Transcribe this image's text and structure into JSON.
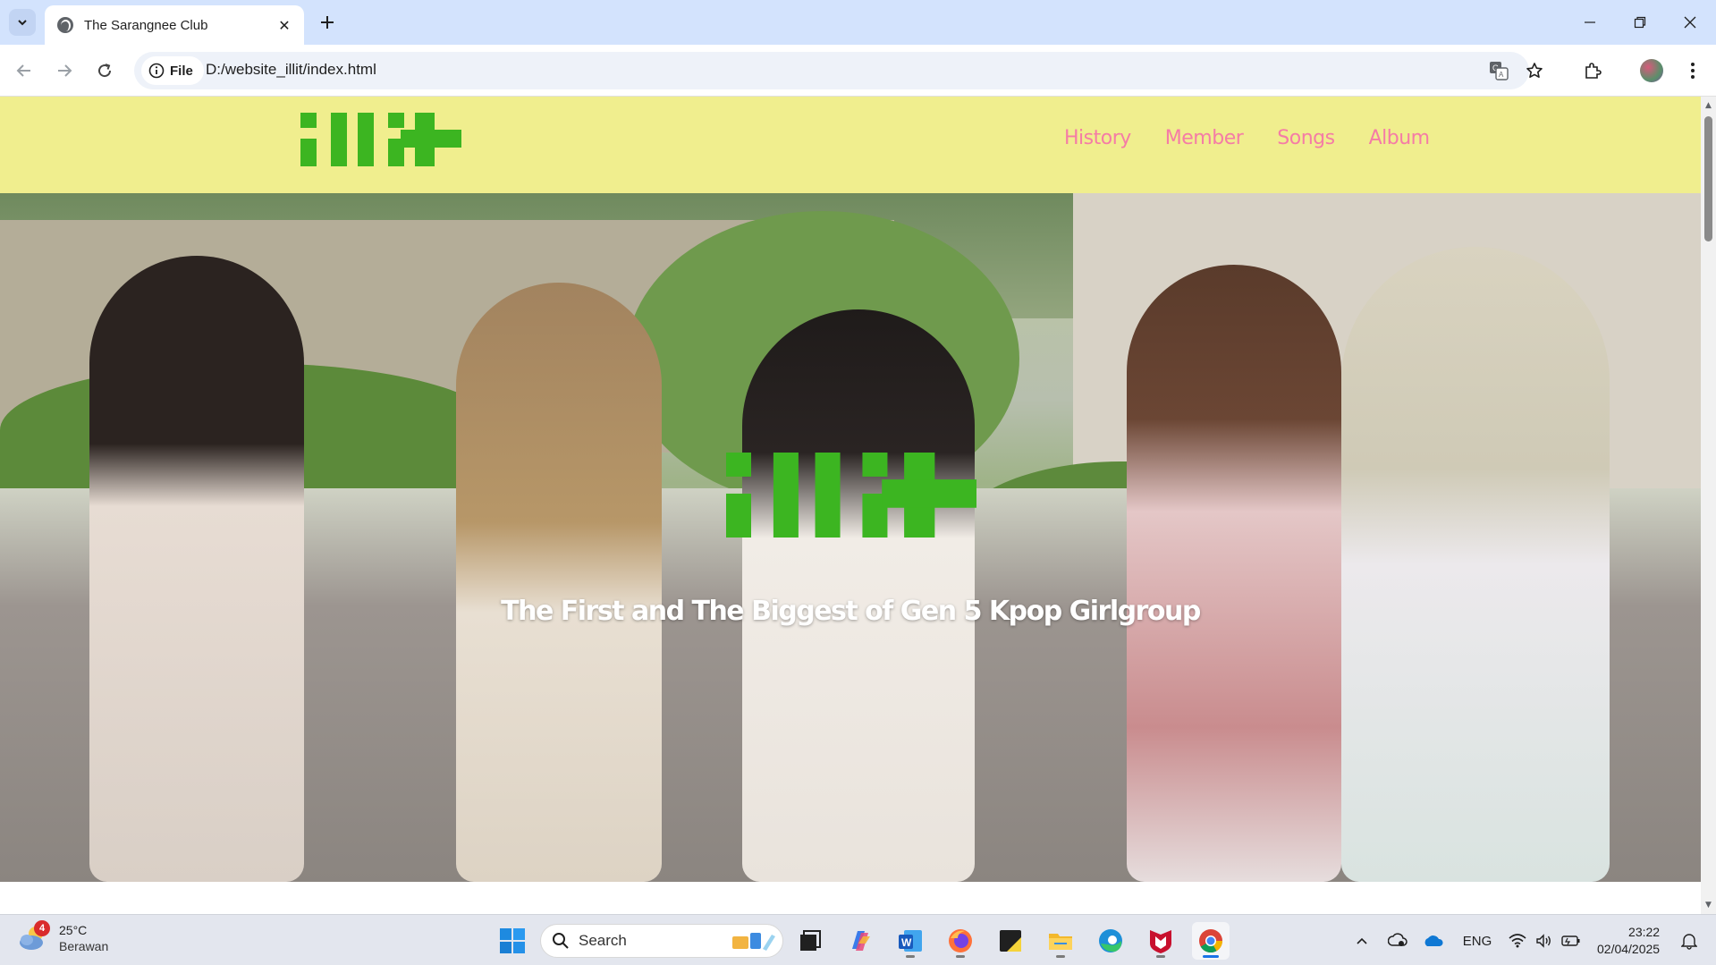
{
  "browser": {
    "tab_title": "The Sarangnee Club",
    "site_chip_label": "File",
    "url": "D:/website_illit/index.html"
  },
  "site": {
    "nav": [
      {
        "label": "History"
      },
      {
        "label": "Member"
      },
      {
        "label": "Songs"
      },
      {
        "label": "Album"
      }
    ],
    "hero_tagline": "The First and The Biggest of Gen 5 Kpop Girlgroup",
    "brand_color": "#3cb521",
    "header_bg": "#f0ee8e",
    "nav_color": "#f57ca6"
  },
  "taskbar": {
    "weather_badge": "4",
    "weather_temp": "25°C",
    "weather_desc": "Berawan",
    "search_label": "Search",
    "language": "ENG",
    "time": "23:22",
    "date": "02/04/2025"
  }
}
